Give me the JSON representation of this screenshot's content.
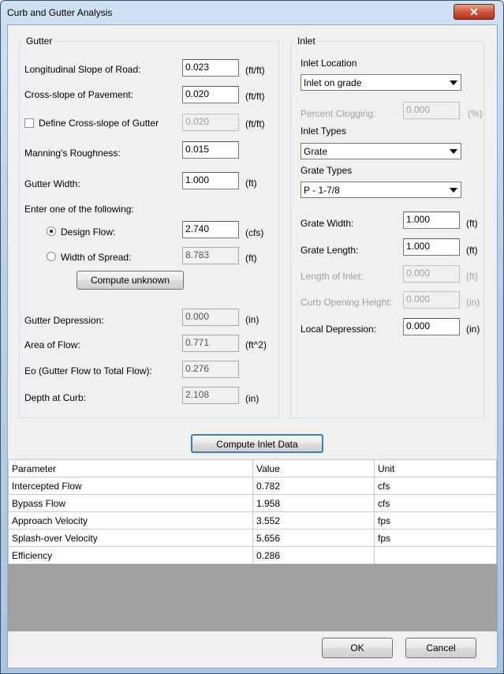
{
  "window": {
    "title": "Curb and Gutter Analysis",
    "close_glyph": "✕"
  },
  "gutter": {
    "group_label": "Gutter",
    "long_slope": {
      "label": "Longitudinal Slope of Road:",
      "value": "0.023",
      "unit": "(ft/ft)"
    },
    "cross_slope": {
      "label": "Cross-slope of Pavement:",
      "value": "0.020",
      "unit": "(ft/ft)"
    },
    "define_cross": {
      "label": "Define Cross-slope of Gutter",
      "value": "0.020",
      "unit": "(ft/ft)",
      "checked": false
    },
    "manning": {
      "label": "Manning's Roughness:",
      "value": "0.015"
    },
    "gutter_width": {
      "label": "Gutter Width:",
      "value": "1.000",
      "unit": "(ft)"
    },
    "enter_one": "Enter one of the following:",
    "design_flow": {
      "label": "Design Flow:",
      "value": "2.740",
      "unit": "(cfs)",
      "selected": true
    },
    "width_spread": {
      "label": "Width of Spread:",
      "value": "8.783",
      "unit": "(ft)",
      "selected": false
    },
    "compute_unknown": "Compute unknown",
    "depression": {
      "label": "Gutter Depression:",
      "value": "0.000",
      "unit": "(in)"
    },
    "area_flow": {
      "label": "Area of Flow:",
      "value": "0.771",
      "unit": "(ft^2)"
    },
    "eo": {
      "label": "Eo (Gutter Flow to Total Flow):",
      "value": "0.276"
    },
    "depth_curb": {
      "label": "Depth at Curb:",
      "value": "2.108",
      "unit": "(in)"
    }
  },
  "inlet": {
    "group_label": "Inlet",
    "location_label": "Inlet Location",
    "location_value": "Inlet on grade",
    "clogging": {
      "label": "Percent Clogging:",
      "value": "0.000",
      "unit": "(%)"
    },
    "types_label": "Inlet Types",
    "types_value": "Grate",
    "grate_types_label": "Grate Types",
    "grate_types_value": "P - 1-7/8",
    "grate_width": {
      "label": "Grate Width:",
      "value": "1.000",
      "unit": "(ft)"
    },
    "grate_length": {
      "label": "Grate Length:",
      "value": "1.000",
      "unit": "(ft)"
    },
    "length_inlet": {
      "label": "Length of Inlet:",
      "value": "0.000",
      "unit": "(ft)"
    },
    "curb_height": {
      "label": "Curb Opening Height:",
      "value": "0.000",
      "unit": "(in)"
    },
    "local_depression": {
      "label": "Local Depression:",
      "value": "0.000",
      "unit": "(in)"
    }
  },
  "compute_inlet": "Compute Inlet Data",
  "results": {
    "headers": [
      "Parameter",
      "Value",
      "Unit"
    ],
    "rows": [
      [
        "Intercepted Flow",
        "0.782",
        "cfs"
      ],
      [
        "Bypass Flow",
        "1.958",
        "cfs"
      ],
      [
        "Approach Velocity",
        "3.552",
        "fps"
      ],
      [
        "Splash-over Velocity",
        "5.656",
        "fps"
      ],
      [
        "Efficiency",
        "0.286",
        ""
      ]
    ]
  },
  "buttons": {
    "ok": "OK",
    "cancel": "Cancel"
  }
}
